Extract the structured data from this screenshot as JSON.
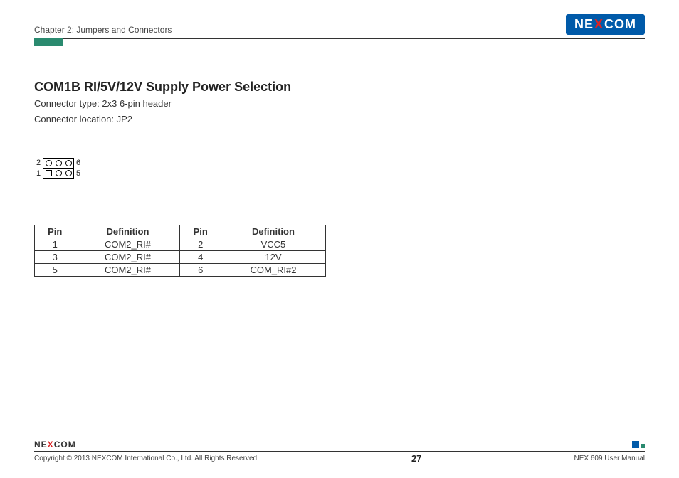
{
  "header": {
    "chapter": "Chapter 2: Jumpers and Connectors",
    "brand_part1": "NE",
    "brand_x": "X",
    "brand_part2": "COM"
  },
  "section": {
    "title": "COM1B RI/5V/12V Supply Power Selection",
    "connector_type": "Connector type: 2x3 6-pin header",
    "connector_location": "Connector location: JP2"
  },
  "pin_diagram": {
    "top_left_label": "2",
    "top_right_label": "6",
    "bottom_left_label": "1",
    "bottom_right_label": "5"
  },
  "table": {
    "headers": {
      "pin": "Pin",
      "definition": "Definition"
    },
    "rows": [
      {
        "pin_a": "1",
        "def_a": "COM2_RI#",
        "pin_b": "2",
        "def_b": "VCC5"
      },
      {
        "pin_a": "3",
        "def_a": "COM2_RI#",
        "pin_b": "4",
        "def_b": "12V"
      },
      {
        "pin_a": "5",
        "def_a": "COM2_RI#",
        "pin_b": "6",
        "def_b": "COM_RI#2"
      }
    ]
  },
  "footer": {
    "copyright": "Copyright © 2013 NEXCOM International Co., Ltd. All Rights Reserved.",
    "page_number": "27",
    "manual": "NEX 609 User Manual",
    "brand_part1": "NE",
    "brand_x": "X",
    "brand_part2": "COM"
  }
}
